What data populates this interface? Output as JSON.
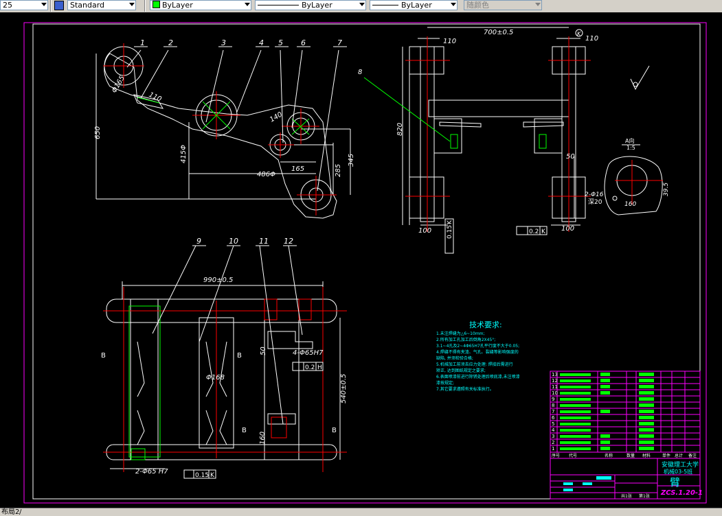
{
  "toolbar": {
    "size_value": "25",
    "text_style": "Standard",
    "layer_color": "ByLayer",
    "linetype": "ByLayer",
    "lineweight": "ByLayer",
    "plot_style": "随颜色",
    "layer_color_swatch": "#00ff00"
  },
  "status": {
    "layout_tab": "布局2"
  },
  "drawing": {
    "balloons": [
      "1",
      "2",
      "3",
      "4",
      "5",
      "6",
      "7",
      "8",
      "9",
      "10",
      "11",
      "12"
    ],
    "dims_top_left": {
      "d165": "Φ165",
      "d110": "110",
      "d650": "650",
      "d415": "415Φ",
      "d140": "140",
      "d165b": "165",
      "d486": "486Φ",
      "d285": "285",
      "d345": "345"
    },
    "dims_top_right": {
      "d700": "700±0.5",
      "d110a": "110",
      "d110b": "110",
      "d820": "820",
      "d100a": "100",
      "d100b": "100",
      "d50": "50",
      "tol_a": "0.15",
      "tol_a_ref": "K",
      "tol_b": "0.2",
      "tol_b_ref": "K",
      "circle_ref": "K"
    },
    "dims_bottom": {
      "d990": "990±0.5",
      "d540": "540±0.5",
      "d168": "Φ168",
      "d50": "50",
      "d160": "160",
      "holes": "4-Φ65H7",
      "holes2": "2-Φ65 H7",
      "tol_c": "0.2",
      "tol_c_ref": "H",
      "tol_d": "0.15",
      "tol_d_ref": "K",
      "sec_b": "B"
    },
    "detail": {
      "title": "A向",
      "scale": "1:5",
      "holes": "2-Φ16",
      "depth": "深20",
      "d160": "160",
      "d39": "39.5"
    },
    "tech_req": {
      "title": "技术要求:",
      "lines": [
        "1.未注焊缝为△6~10mm;",
        "2.所有加工孔加工后倒角2X45°;",
        "3.1~4孔及2~4Φ65H7孔平行度不大于0.05;",
        "4.焊缝不得有夹渣、气孔、裂缝等影响强度的",
        "   缺陷, 并须检验合格;",
        "5.机械加工前须去应力处理: 焊接后需进行",
        "   矫正, 达到图纸规定之要求;",
        "6.表面喷漆前进行除锈处理后喷底漆,未注喷漆",
        "   漆按规定;",
        "7.其它要求遵照有关标准执行。"
      ]
    },
    "title_block": {
      "school": "安徽理工大学",
      "class_name": "机械03-5班",
      "part_name": "臂",
      "drawing_no": "ZCS.1.20-1",
      "footer": [
        "共1张",
        "第1张"
      ],
      "header_row": [
        "序号",
        "代号",
        "名称",
        "数量",
        "材料",
        "单件",
        "总计",
        "备注"
      ],
      "row_numbers": [
        "13",
        "12",
        "11",
        "10",
        "9",
        "8",
        "7",
        "6",
        "5",
        "4",
        "3",
        "2",
        "1"
      ]
    }
  }
}
